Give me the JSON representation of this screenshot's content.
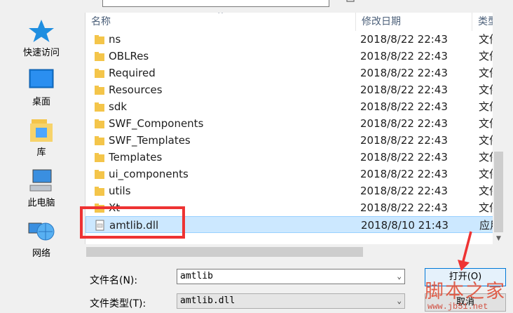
{
  "nav": [
    {
      "label": "快速访问",
      "icon": "star-icon"
    },
    {
      "label": "桌面",
      "icon": "desktop-icon"
    },
    {
      "label": "库",
      "icon": "library-icon"
    },
    {
      "label": "此电脑",
      "icon": "computer-icon"
    },
    {
      "label": "网络",
      "icon": "network-icon"
    }
  ],
  "columns": {
    "name": "名称",
    "date": "修改日期",
    "type": "类型"
  },
  "rows": [
    {
      "name": "ns",
      "date": "2018/8/22 22:43",
      "type": "文件夹",
      "icon": "folder-icon"
    },
    {
      "name": "OBLRes",
      "date": "2018/8/22 22:43",
      "type": "文件夹",
      "icon": "folder-icon"
    },
    {
      "name": "Required",
      "date": "2018/8/22 22:43",
      "type": "文件夹",
      "icon": "folder-icon"
    },
    {
      "name": "Resources",
      "date": "2018/8/22 22:43",
      "type": "文件夹",
      "icon": "folder-icon"
    },
    {
      "name": "sdk",
      "date": "2018/8/22 22:43",
      "type": "文件夹",
      "icon": "folder-icon"
    },
    {
      "name": "SWF_Components",
      "date": "2018/8/22 22:43",
      "type": "文件夹",
      "icon": "folder-icon"
    },
    {
      "name": "SWF_Templates",
      "date": "2018/8/22 22:43",
      "type": "文件夹",
      "icon": "folder-icon"
    },
    {
      "name": "Templates",
      "date": "2018/8/22 22:43",
      "type": "文件夹",
      "icon": "folder-icon"
    },
    {
      "name": "ui_components",
      "date": "2018/8/22 22:43",
      "type": "文件夹",
      "icon": "folder-icon"
    },
    {
      "name": "utils",
      "date": "2018/8/22 22:43",
      "type": "文件夹",
      "icon": "folder-icon"
    },
    {
      "name": "Xt",
      "date": "2018/8/22 22:43",
      "type": "文件夹",
      "icon": "folder-icon"
    },
    {
      "name": "amtlib.dll",
      "date": "2018/8/10 21:43",
      "type": "应用程序扩展",
      "icon": "dll-file-icon",
      "selected": true
    }
  ],
  "form": {
    "filename_label": "文件名(N):",
    "filename_value": "amtlib",
    "filetype_label": "文件类型(T):",
    "filetype_value": "amtlib.dll",
    "open_label": "打开(O)",
    "cancel_label": "取消"
  },
  "watermark": {
    "title": "脚本之家",
    "url": "www.jb51.net"
  },
  "colors": {
    "folder": "#f4c54a",
    "accent": "#0078d7",
    "highlight": "#e33333",
    "selection": "#cce8ff"
  }
}
